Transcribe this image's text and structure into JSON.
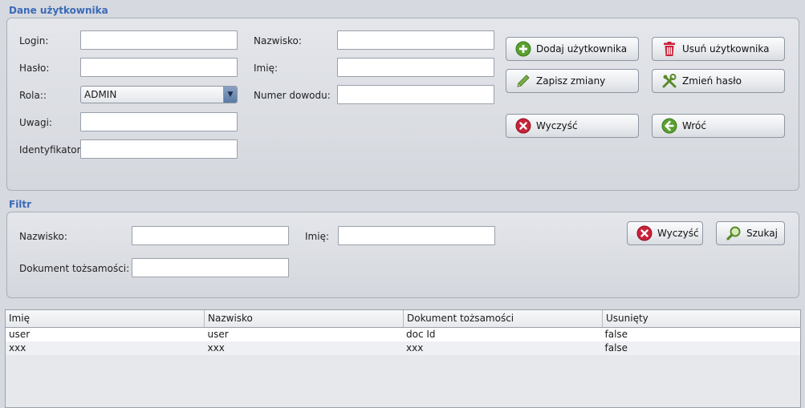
{
  "user_section": {
    "title": "Dane użytkownika",
    "labels": {
      "login": "Login:",
      "password": "Hasło:",
      "role": "Rola::",
      "notes": "Uwagi:",
      "identifier": "Identyfikator:",
      "surname": "Nazwisko:",
      "name": "Imię:",
      "id_number": "Numer dowodu:"
    },
    "values": {
      "login": "",
      "password": "",
      "notes": "",
      "identifier": "",
      "surname": "",
      "name": "",
      "id_number": ""
    },
    "role_selected": "ADMIN",
    "buttons": {
      "add_user": "Dodaj użytkownika",
      "delete_user": "Usuń użytkownika",
      "save_changes": "Zapisz zmiany",
      "change_password": "Zmień hasło",
      "clear": "Wyczyść",
      "back": "Wróć"
    }
  },
  "filter_section": {
    "title": "Filtr",
    "labels": {
      "surname": "Nazwisko:",
      "name": "Imię:",
      "document": "Dokument tożsamości:"
    },
    "values": {
      "surname": "",
      "name": "",
      "document": ""
    },
    "buttons": {
      "clear": "Wyczyść",
      "search": "Szukaj"
    }
  },
  "table": {
    "columns": [
      "Imię",
      "Nazwisko",
      "Dokument tożsamości",
      "Usunięty"
    ],
    "rows": [
      [
        "user",
        "user",
        "doc Id",
        "false"
      ],
      [
        "xxx",
        "xxx",
        "xxx",
        "false"
      ]
    ]
  },
  "colors": {
    "section_title": "#3a6ab8",
    "add_icon": "#5aa030",
    "delete_icon": "#c8233a",
    "clear_icon": "#c8233a",
    "back_icon": "#5aa030"
  },
  "icons": {
    "add_user": "plus-circle-icon",
    "delete_user": "trash-icon",
    "save_changes": "pencil-icon",
    "change_password": "tools-icon",
    "clear": "x-circle-icon",
    "back": "arrow-left-circle-icon",
    "search": "magnifier-icon"
  }
}
